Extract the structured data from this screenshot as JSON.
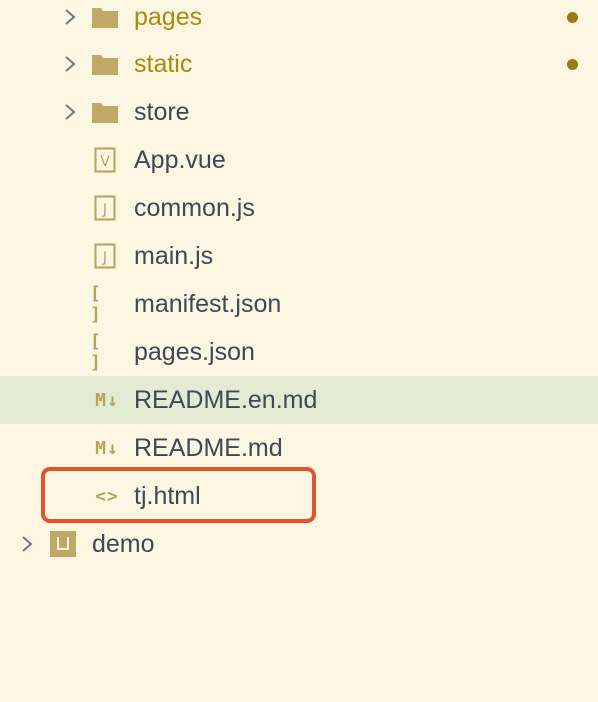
{
  "tree": {
    "items": [
      {
        "label": "pages",
        "type": "folder",
        "modified": true
      },
      {
        "label": "static",
        "type": "folder",
        "modified": true
      },
      {
        "label": "store",
        "type": "folder",
        "modified": false
      },
      {
        "label": "App.vue",
        "type": "file",
        "icon": "vue-file-icon",
        "glyph": "V"
      },
      {
        "label": "common.js",
        "type": "file",
        "icon": "js-file-icon",
        "glyph": "J"
      },
      {
        "label": "main.js",
        "type": "file",
        "icon": "js-file-icon",
        "glyph": "J"
      },
      {
        "label": "manifest.json",
        "type": "file",
        "icon": "json-file-icon",
        "glyph": "[ ]"
      },
      {
        "label": "pages.json",
        "type": "file",
        "icon": "json-file-icon",
        "glyph": "[ ]"
      },
      {
        "label": "README.en.md",
        "type": "file",
        "icon": "markdown-file-icon",
        "glyph": "M↓",
        "selected": true
      },
      {
        "label": "README.md",
        "type": "file",
        "icon": "markdown-file-icon",
        "glyph": "M↓"
      },
      {
        "label": "tj.html",
        "type": "file",
        "icon": "html-file-icon",
        "glyph": "<>",
        "highlighted": true
      },
      {
        "label": "demo",
        "type": "project",
        "icon": "project-folder-icon"
      }
    ]
  },
  "colors": {
    "background": "#fdf6e3",
    "selected_row": "#e4ebd3",
    "text": "#3b4a55",
    "modified_text": "#a88a0f",
    "modified_dot": "#9a7a12",
    "icon": "#b9a35a",
    "highlight_border": "#e4532f"
  }
}
